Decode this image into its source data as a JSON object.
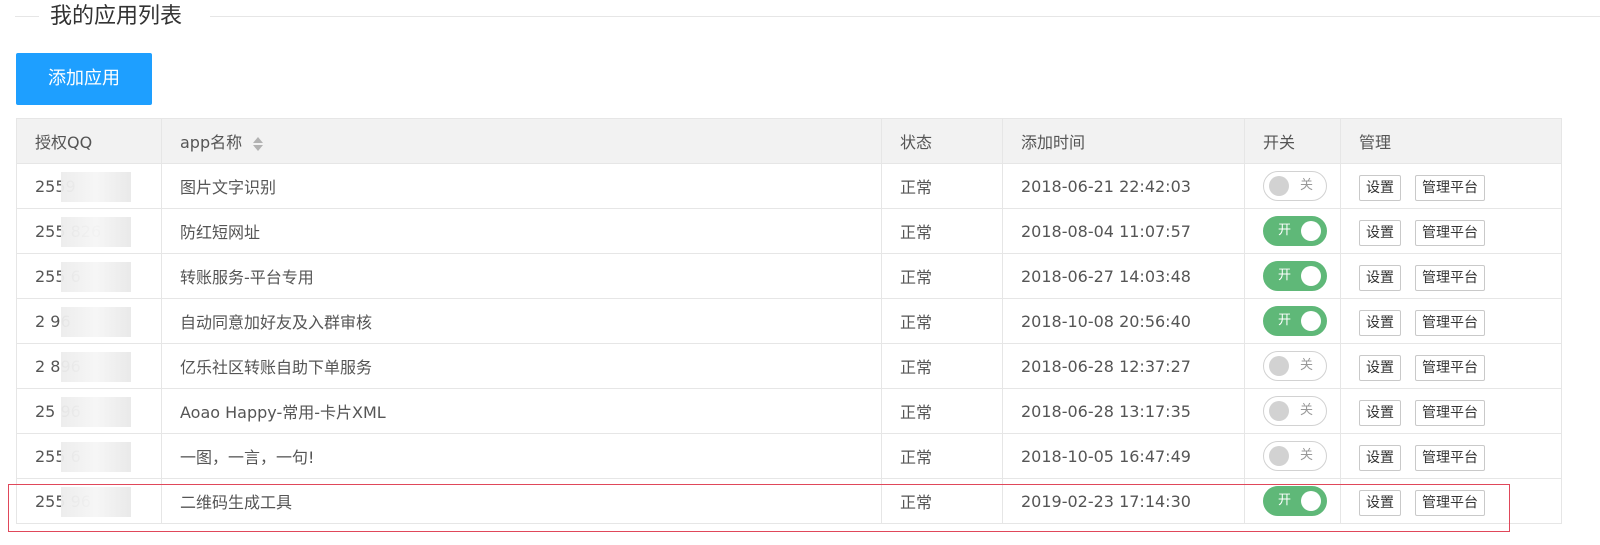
{
  "page": {
    "title": "我的应用列表",
    "add_button_label": "添加应用"
  },
  "colors": {
    "primary": "#1e9fff",
    "switch_on": "#5fb878",
    "switch_off_border": "#d2d2d2",
    "highlight": "#e0475a"
  },
  "table": {
    "headers": {
      "qq": "授权QQ",
      "app_name": "app名称",
      "status": "状态",
      "added_time": "添加时间",
      "switch": "开关",
      "manage": "管理"
    },
    "switch_labels": {
      "on": "开",
      "off": "关"
    },
    "action_labels": {
      "settings": "设置",
      "platform": "管理平台"
    },
    "rows": [
      {
        "qq": "2559",
        "app_name": "图片文字识别",
        "status": "正常",
        "added_time": "2018-06-21 22:42:03",
        "switch": "off"
      },
      {
        "qq": "255 826",
        "app_name": "防红短网址",
        "status": "正常",
        "added_time": "2018-08-04 11:07:57",
        "switch": "on"
      },
      {
        "qq": "255 6",
        "app_name": "转账服务-平台专用",
        "status": "正常",
        "added_time": "2018-06-27 14:03:48",
        "switch": "on"
      },
      {
        "qq": "2 96",
        "app_name": "自动同意加好友及入群审核",
        "status": "正常",
        "added_time": "2018-10-08 20:56:40",
        "switch": "on"
      },
      {
        "qq": "2 896",
        "app_name": "亿乐社区转账自助下单服务",
        "status": "正常",
        "added_time": "2018-06-28 12:37:27",
        "switch": "off"
      },
      {
        "qq": "25 96",
        "app_name": "Aoao Happy-常用-卡片XML",
        "status": "正常",
        "added_time": "2018-06-28 13:17:35",
        "switch": "off"
      },
      {
        "qq": "255 6",
        "app_name": "一图，一言，一句!",
        "status": "正常",
        "added_time": "2018-10-05 16:47:49",
        "switch": "off"
      },
      {
        "qq": "255 96",
        "app_name": "二维码生成工具",
        "status": "正常",
        "added_time": "2019-02-23 17:14:30",
        "switch": "on"
      }
    ]
  }
}
